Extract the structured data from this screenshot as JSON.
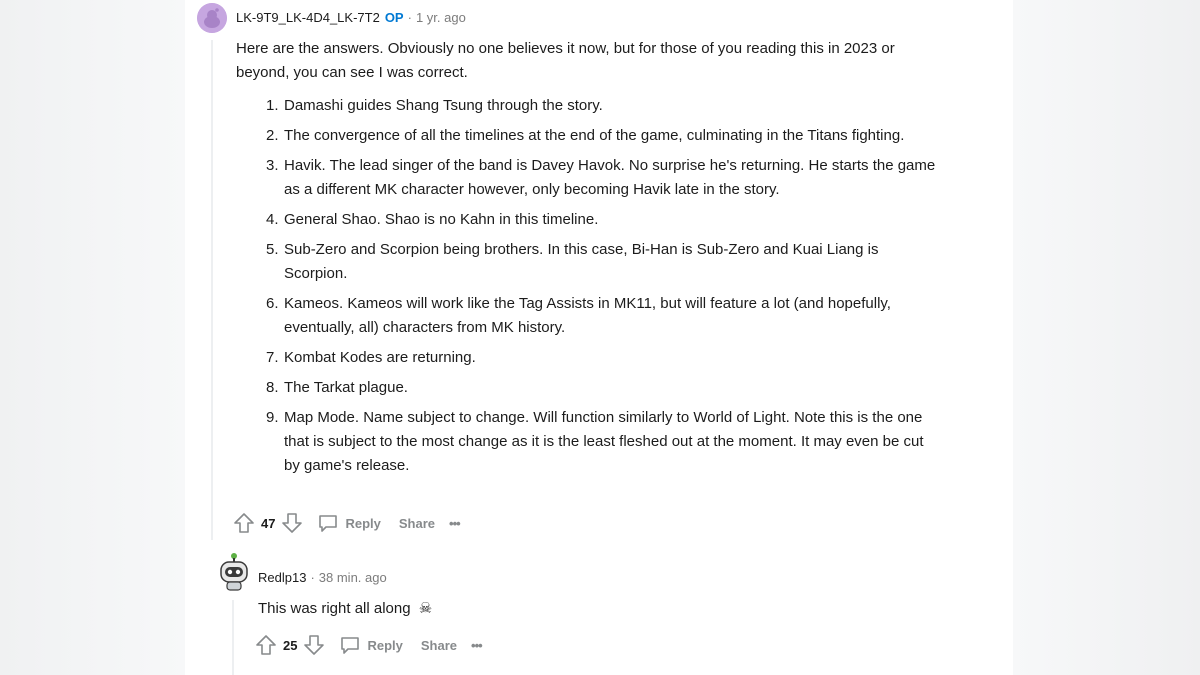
{
  "comment1": {
    "username": "LK-9T9_LK-4D4_LK-7T2",
    "op_badge": "OP",
    "separator": "·",
    "time": "1 yr. ago",
    "intro": "Here are the answers. Obviously no one believes it now, but for those of you reading this in 2023 or beyond, you can see I was correct.",
    "items": [
      {
        "num": "1.",
        "text": "Damashi guides Shang Tsung through the story."
      },
      {
        "num": "2.",
        "text": "The convergence of all the timelines at the end of the game, culminating in the Titans fighting."
      },
      {
        "num": "3.",
        "text": "Havik. The lead singer of the band is Davey Havok. No surprise he's returning. He starts the game as a different MK character however, only becoming Havik late in the story."
      },
      {
        "num": "4.",
        "text": "General Shao. Shao is no Kahn in this timeline."
      },
      {
        "num": "5.",
        "text": "Sub-Zero and Scorpion being brothers. In this case, Bi-Han is Sub-Zero and Kuai Liang is Scorpion."
      },
      {
        "num": "6.",
        "text": "Kameos. Kameos will work like the Tag Assists in MK11, but will feature a lot (and hopefully, eventually, all) characters from MK history."
      },
      {
        "num": "7.",
        "text": "Kombat Kodes are returning."
      },
      {
        "num": "8.",
        "text": "The Tarkat plague."
      },
      {
        "num": "9.",
        "text": "Map Mode. Name subject to change. Will function similarly to World of Light. Note this is the one that is subject to the most change as it is the least fleshed out at the moment. It may even be cut by game's release."
      }
    ],
    "score": "47",
    "reply_label": "Reply",
    "share_label": "Share",
    "more_label": "•••"
  },
  "comment2": {
    "username": "Redlp13",
    "separator": "·",
    "time": "38 min. ago",
    "text": "This was right all along",
    "emoji": "☠",
    "score": "25",
    "reply_label": "Reply",
    "share_label": "Share",
    "more_label": "•••"
  },
  "icons": {
    "upvote": "upvote-icon",
    "downvote": "downvote-icon",
    "reply": "comment-bubble-icon",
    "avatar1": "snoo-avatar-purple",
    "avatar2": "snoo-avatar-robot"
  },
  "colors": {
    "op": "#0079d3",
    "avatar1": "#c6a6e0",
    "muted": "#878a8c"
  }
}
